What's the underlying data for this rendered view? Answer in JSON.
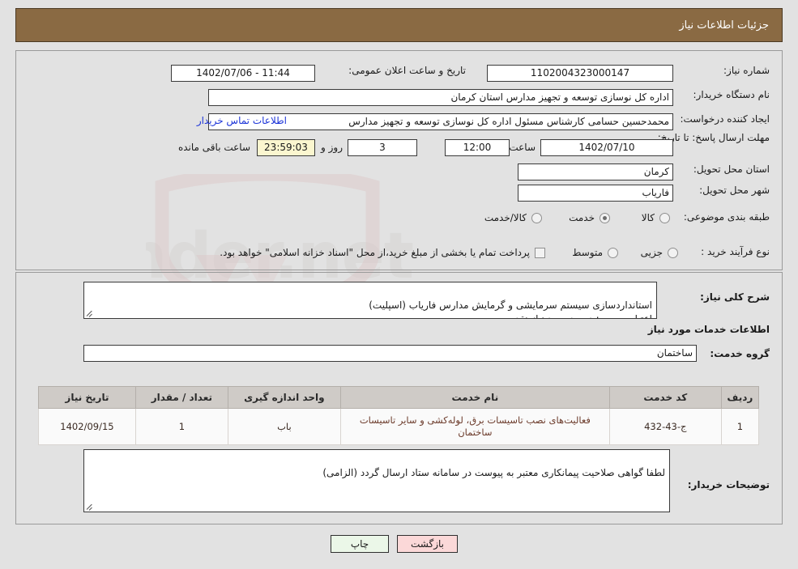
{
  "header": {
    "title": "جزئیات اطلاعات نیاز"
  },
  "watermark": {
    "text": "AriaTender.net"
  },
  "top_panel": {
    "need_number": {
      "label": "شماره نیاز:",
      "value": "1102004323000147"
    },
    "announce_datetime": {
      "label": "تاریخ و ساعت اعلان عمومی:",
      "value": "11:44 - 1402/07/06"
    },
    "buyer_org": {
      "label": "نام دستگاه خریدار:",
      "value": "اداره کل نوسازی  توسعه و تجهیز مدارس استان کرمان"
    },
    "requester": {
      "label": "ایجاد کننده درخواست:",
      "value": "محمدحسین حسامی کارشناس مسئول اداره کل نوسازی  توسعه و تجهیز مدارس",
      "contact_link": "اطلاعات تماس خریدار"
    },
    "deadline": {
      "label": "مهلت ارسال پاسخ: تا تاریخ:",
      "date": "1402/07/10",
      "time_label": "ساعت",
      "time": "12:00",
      "days": "3",
      "days_label": "روز و",
      "countdown": "23:59:03",
      "remaining_label": "ساعت باقی مانده"
    },
    "province": {
      "label": "استان محل تحویل:",
      "value": "کرمان"
    },
    "city": {
      "label": "شهر محل تحویل:",
      "value": "فاریاب"
    },
    "classification": {
      "label": "طبقه بندی موضوعی:",
      "options": [
        {
          "label": "کالا",
          "selected": false
        },
        {
          "label": "خدمت",
          "selected": true
        },
        {
          "label": "کالا/خدمت",
          "selected": false
        }
      ]
    },
    "process_type": {
      "label": "نوع فرآیند خرید :",
      "options": [
        {
          "label": "جزیی",
          "selected": false
        },
        {
          "label": "متوسط",
          "selected": false
        }
      ],
      "treasury_checkbox": {
        "checked": false,
        "label": "پرداخت تمام یا بخشی از مبلغ خرید،از محل \"اسناد خزانه اسلامی\" خواهد بود."
      }
    }
  },
  "bottom_panel": {
    "general_description": {
      "label": "شرح کلی نیاز:",
      "value": "استانداردسازی سیستم سرمایشی و گرمایش مدارس فاریاب (اسپلیت)\nاعتبار مصوب: در حد مورد نیاز نقد"
    },
    "services_heading": "اطلاعات خدمات مورد نیاز",
    "service_group": {
      "label": "گروه خدمت:",
      "value": "ساختمان"
    },
    "table": {
      "columns": [
        "ردیف",
        "کد خدمت",
        "نام خدمت",
        "واحد اندازه گیری",
        "تعداد / مقدار",
        "تاریخ نیاز"
      ],
      "rows": [
        {
          "row_no": "1",
          "service_code": "ج-43-432",
          "service_name": "فعالیت‌های نصب تاسیسات برق، لوله‌کشی و سایر تاسیسات ساختمان",
          "unit": "باب",
          "quantity": "1",
          "need_date": "1402/09/15"
        }
      ]
    },
    "buyer_notes": {
      "label": "توضیحات خریدار:",
      "value": "لطفا گواهی صلاحیت پیمانکاری معتبر به پیوست در سامانه ستاد ارسال گردد (الزامی)"
    }
  },
  "footer": {
    "print_label": "چاپ",
    "back_label": "بازگشت"
  }
}
